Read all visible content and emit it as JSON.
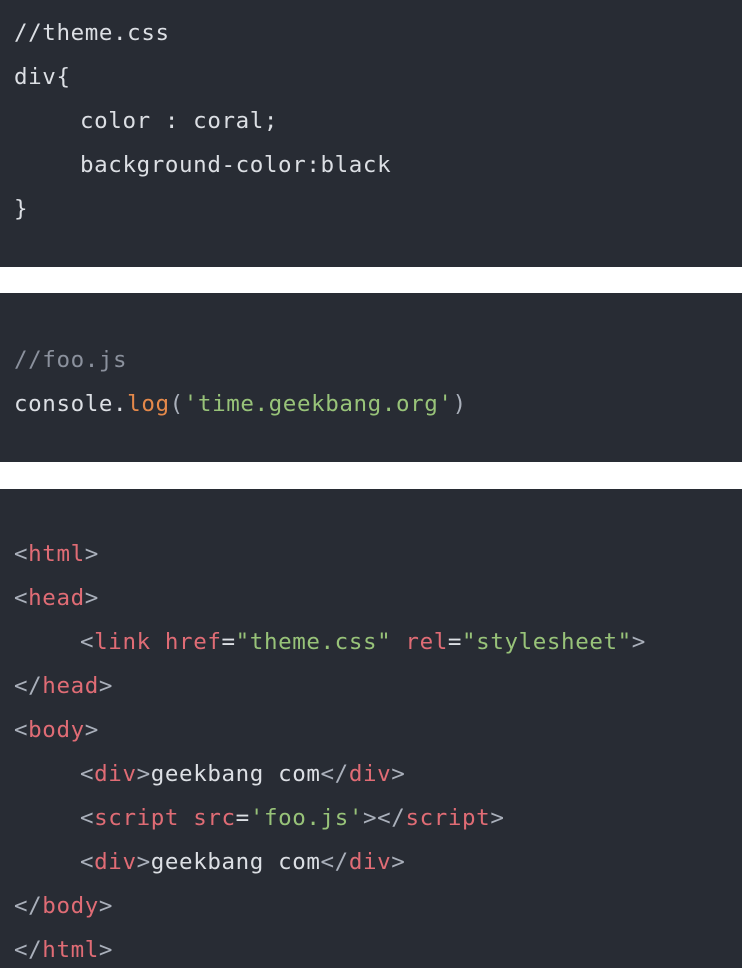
{
  "css_block": {
    "comment": "//theme.css",
    "selector": "div{",
    "prop1": "color : coral;",
    "prop2": "background-color:black",
    "close": "}"
  },
  "js_block": {
    "comment": "//foo.js",
    "obj": "console.",
    "fn": "log",
    "open": "(",
    "str": "'time.geekbang.org'",
    "close": ")"
  },
  "html_block": {
    "lt": "<",
    "lt_slash": "</",
    "gt": ">",
    "eq": "=",
    "tag_html": "html",
    "tag_head": "head",
    "tag_link": "link",
    "tag_body": "body",
    "tag_div": "div",
    "tag_script": "script",
    "attr_href": "href",
    "attr_rel": "rel",
    "attr_src": "src",
    "val_href": "\"theme.css\"",
    "val_rel": "\"stylesheet\"",
    "val_src": "'foo.js'",
    "div_text": "geekbang com"
  },
  "colors": {
    "background": "#282c34",
    "plain": "#dcdfe4",
    "comment": "#8b919d",
    "function": "#e5894a",
    "string": "#98c379",
    "tag": "#e06c75",
    "gap": "#ffffff"
  }
}
